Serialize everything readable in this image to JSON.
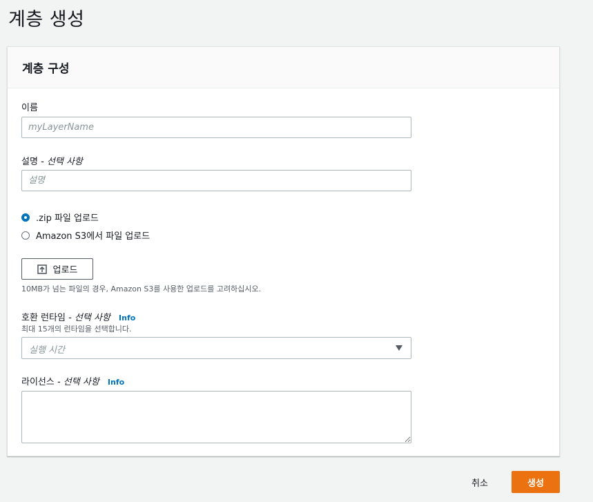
{
  "page": {
    "title": "계층 생성"
  },
  "panel": {
    "title": "계층 구성"
  },
  "name_field": {
    "label": "이름",
    "placeholder": "myLayerName",
    "value": ""
  },
  "description_field": {
    "label": "설명",
    "optional": "- 선택 사항",
    "placeholder": "설명",
    "value": ""
  },
  "upload_options": [
    {
      "label": ".zip 파일 업로드",
      "checked": true
    },
    {
      "label": "Amazon S3에서 파일 업로드",
      "checked": false
    }
  ],
  "upload": {
    "button_label": "업로드",
    "icon": "upload-icon",
    "hint": "10MB가 넘는 파일의 경우, Amazon S3를 사용한 업로드를 고려하십시오."
  },
  "runtimes": {
    "label": "호환 런타임",
    "optional": "- 선택 사항",
    "info_link": "Info",
    "hint": "최대 15개의 런타임을 선택합니다.",
    "placeholder": "실행 시간",
    "icon": "caret-down-icon"
  },
  "license": {
    "label": "라이선스",
    "optional": "- 선택 사항",
    "info_link": "Info",
    "value": ""
  },
  "footer": {
    "cancel_label": "취소",
    "create_label": "생성"
  },
  "colors": {
    "primary_button": "#ec7211",
    "link": "#0073bb",
    "radio_selected": "#0073bb",
    "page_background": "#f2f3f3"
  }
}
